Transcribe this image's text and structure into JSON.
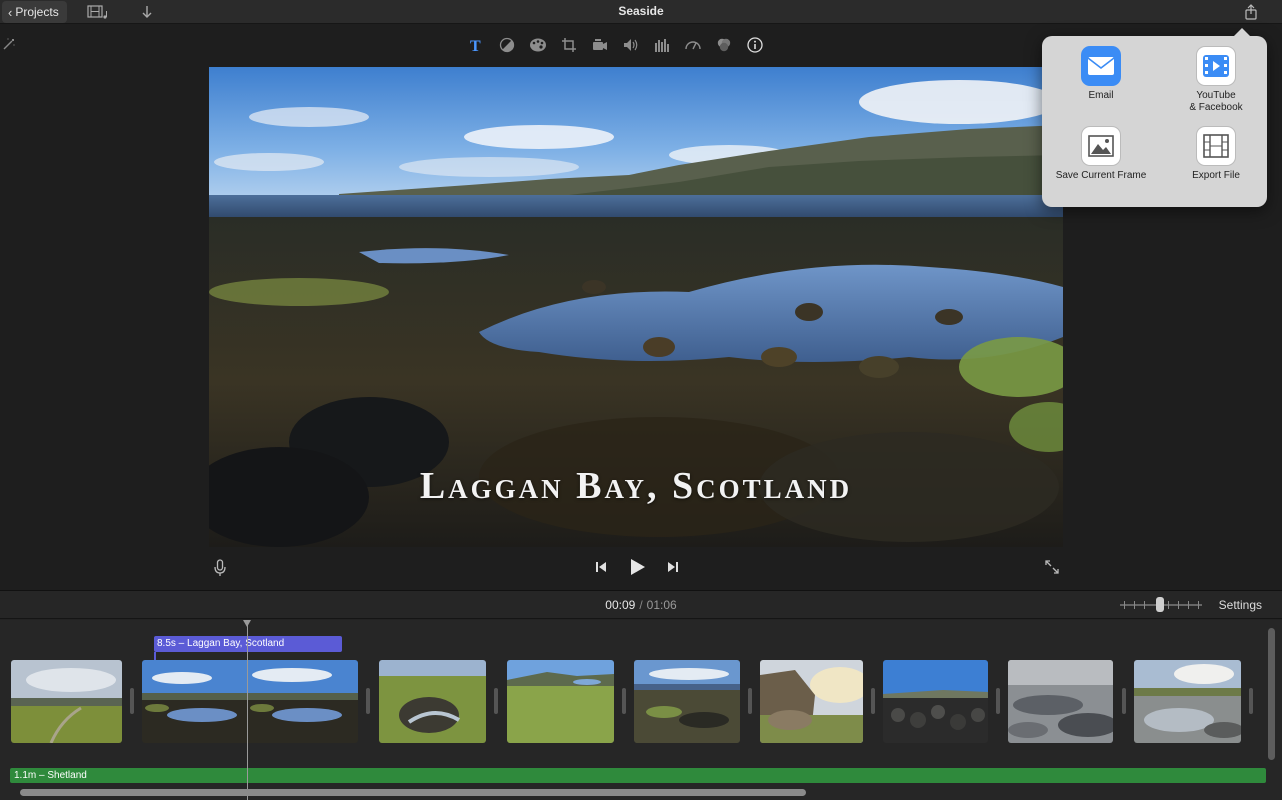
{
  "titlebar": {
    "projects_label": "Projects",
    "title": "Seaside",
    "icons": [
      "media-browser-icon",
      "import-arrow-icon",
      "share-icon"
    ]
  },
  "toolbar": {
    "tools": [
      "title-icon",
      "color-balance-icon",
      "color-correction-icon",
      "crop-icon",
      "stabilization-icon",
      "volume-icon",
      "noise-reduction-icon",
      "speed-icon",
      "clip-filter-icon",
      "info-icon"
    ],
    "active_tool": "title-icon",
    "active_color": "#4b97ff"
  },
  "viewer": {
    "overlay_title": "Laggan Bay, Scotland"
  },
  "share_popover": {
    "items": [
      {
        "label": "Email",
        "icon": "email-icon",
        "color": "#3b8cf5"
      },
      {
        "label": "YouTube\n& Facebook",
        "icon": "youtube-facebook-icon",
        "color": "#3b8cf5"
      },
      {
        "label": "Save Current Frame",
        "icon": "save-frame-icon",
        "color": "#ffffff"
      },
      {
        "label": "Export File",
        "icon": "export-file-icon",
        "color": "#ffffff"
      }
    ]
  },
  "timeline": {
    "current_time": "00:09",
    "separator": "/",
    "total_time": "01:06",
    "settings_label": "Settings",
    "title_clip_label": "8.5s – Laggan Bay, Scotland",
    "audio_clip_label": "1.1m – Shetland",
    "title_clip_color": "#5b5bd6",
    "audio_clip_color": "#2f8a3c"
  }
}
